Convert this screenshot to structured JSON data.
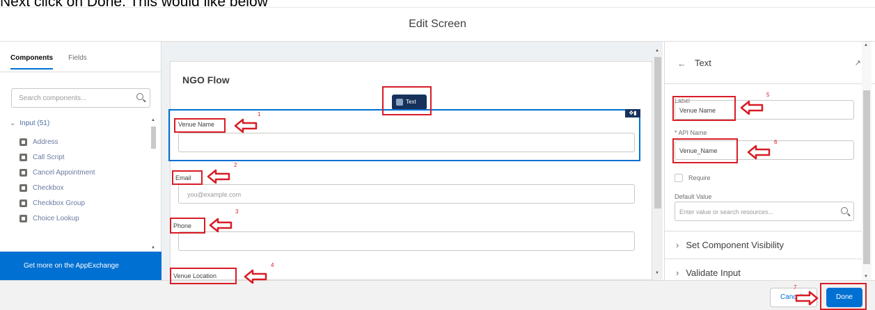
{
  "caption": "Next click on Done. This would like below",
  "modal": {
    "title": "Edit Screen"
  },
  "left_panel": {
    "tabs": [
      {
        "label": "Components"
      },
      {
        "label": "Fields"
      }
    ],
    "search_placeholder": "Search components...",
    "group_label": "Input (51)",
    "components": [
      "Address",
      "Call Script",
      "Cancel Appointment",
      "Checkbox",
      "Checkbox Group",
      "Choice Lookup"
    ],
    "appexchange_label": "Get more on the AppExchange"
  },
  "canvas": {
    "flow_title": "NGO Flow",
    "text_chip_label": "Text",
    "fields": [
      {
        "label": "Venue Name",
        "value": ""
      },
      {
        "label": "Email",
        "placeholder": "you@example.com"
      },
      {
        "label": "Phone",
        "value": ""
      },
      {
        "label": "Venue Location"
      }
    ]
  },
  "properties_panel": {
    "back_icon": "arrow-left-icon",
    "title": "Text",
    "label_field": {
      "label": "Label",
      "value": "Venue Name"
    },
    "api_field": {
      "label": "* API Name",
      "value": "Venue_Name"
    },
    "require_label": "Require",
    "default_value": {
      "label": "Default Value",
      "placeholder": "Enter value or search resources..."
    },
    "sections": [
      "Set Component Visibility",
      "Validate Input"
    ]
  },
  "footer": {
    "cancel_label": "Cancel",
    "done_label": "Done"
  },
  "annotations": {
    "steps": [
      "1",
      "2",
      "3",
      "4",
      "5",
      "6",
      "7"
    ],
    "color": "#d81c25"
  },
  "colors": {
    "brand_blue": "#0070d2",
    "dark_navy": "#16325c"
  }
}
